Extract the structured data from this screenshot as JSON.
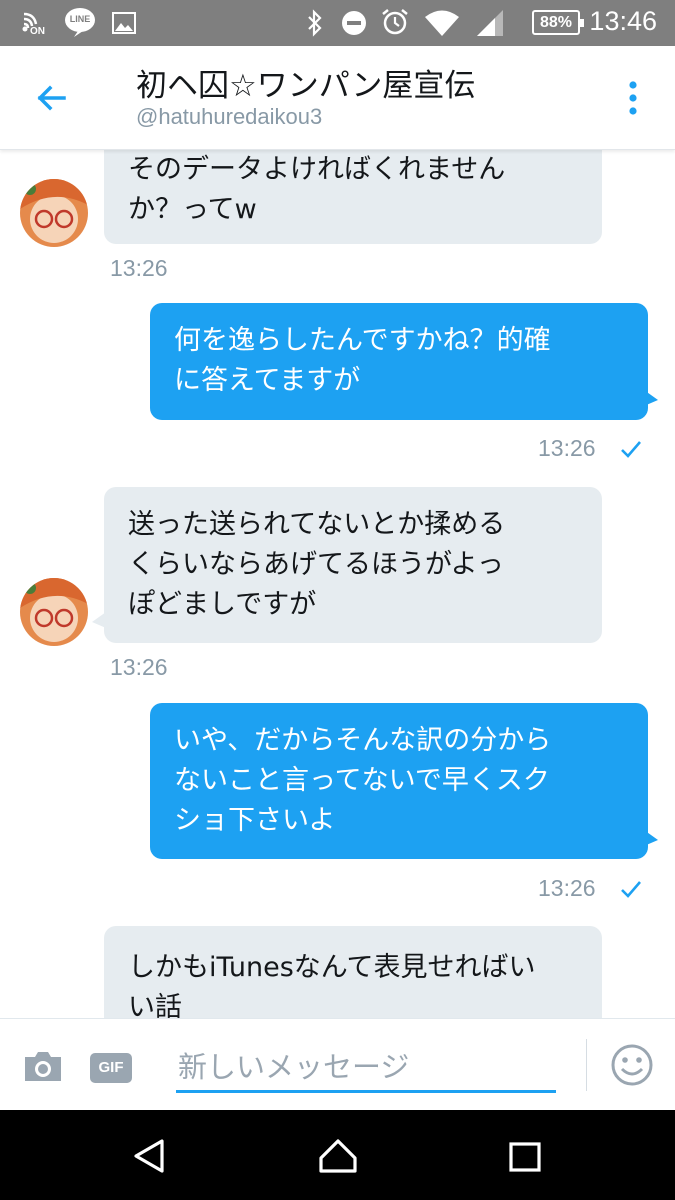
{
  "status_bar": {
    "time": "13:46",
    "battery": "88%",
    "icons": [
      "nfc-on-icon",
      "line-app-icon",
      "gallery-icon",
      "bluetooth-icon",
      "do-not-disturb-icon",
      "alarm-icon",
      "wifi-icon",
      "signal-icon"
    ],
    "nfc_label": "ON",
    "line_label": "LINE"
  },
  "header": {
    "title": "初ヘ囚☆ワンパン屋宣伝",
    "handle": "@hatuhuredaikou3",
    "back_icon": "back-arrow-icon",
    "more_icon": "more-vertical-icon"
  },
  "messages": [
    {
      "direction": "in",
      "text": "そのデータよければくれません\nか？ってw",
      "time": "13:26"
    },
    {
      "direction": "out",
      "text": "何を逸らしたんですかね？的確\nに答えてますが",
      "time": "13:26",
      "read": true
    },
    {
      "direction": "in",
      "text": "送った送られてないとか揉める\nくらいならあげてるほうがよっ\nぽどましですが",
      "time": "13:26"
    },
    {
      "direction": "out",
      "text": "いや、だからそんな訳の分から\nないこと言ってないで早くスク\nショ下さいよ",
      "time": "13:26",
      "read": true
    },
    {
      "direction": "in",
      "text": "しかもiTunesなんて表見せればい\nい話"
    }
  ],
  "composer": {
    "placeholder": "新しいメッセージ",
    "value": "",
    "gif_label": "GIF",
    "camera_icon": "camera-icon",
    "emoji_icon": "emoji-icon"
  },
  "nav_bar": {
    "icons": [
      "back-triangle-icon",
      "home-icon",
      "recents-icon"
    ]
  },
  "colors": {
    "accent": "#1da1f2",
    "incoming_bubble": "#e6ecf0",
    "status_bar": "#7f7f7f",
    "timestamp": "#8899a6"
  }
}
